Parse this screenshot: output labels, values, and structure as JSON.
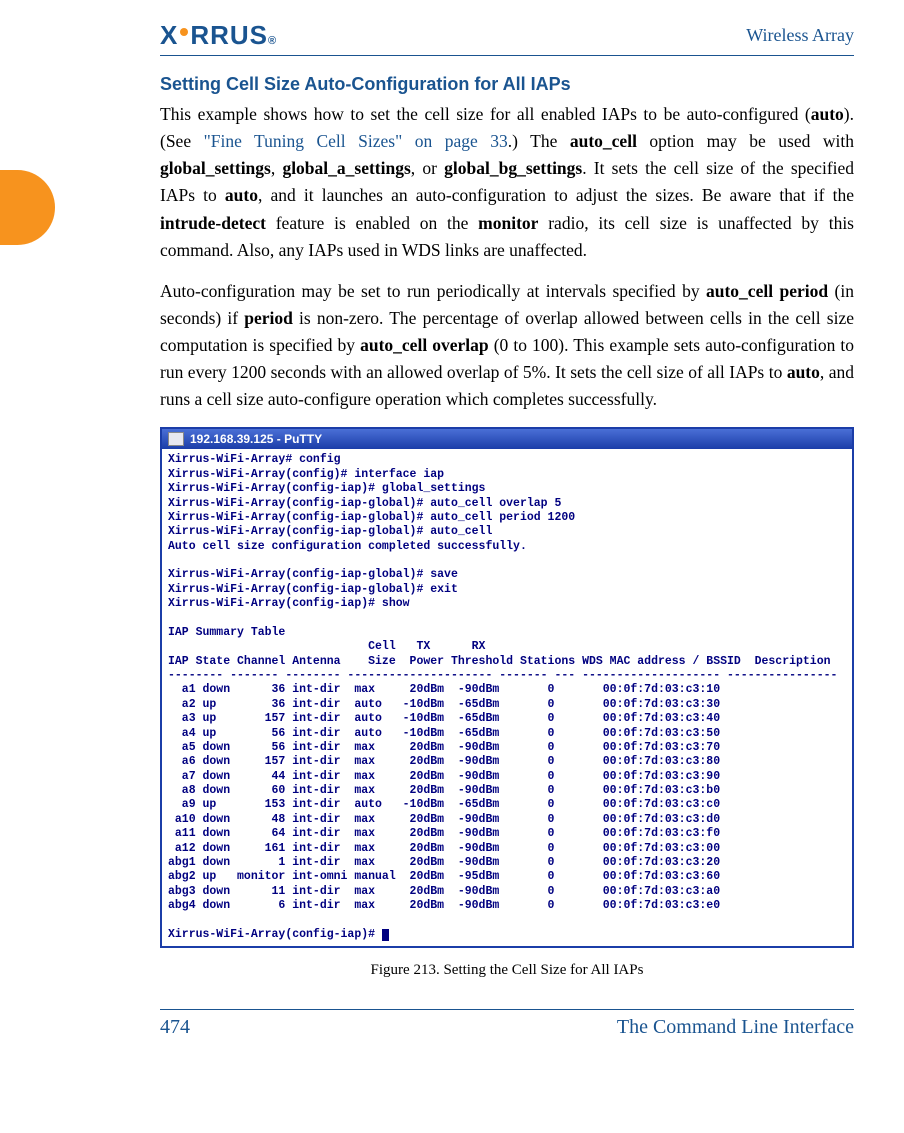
{
  "header": {
    "brand_text": "XIRRUS",
    "doc_title": "Wireless Array"
  },
  "section_title": "Setting Cell Size Auto-Configuration for All IAPs",
  "para1": {
    "t1": "This example shows how to set the cell size for all enabled IAPs to be auto-configured (",
    "bold1": "auto",
    "t2": "). (See ",
    "link1": "\"Fine Tuning Cell Sizes\" on page 33",
    "t3": ".) The ",
    "bold2": "auto_cell",
    "t4": " option may be used with ",
    "bold3": "global_settings",
    "t5": ", ",
    "bold4": "global_a_settings",
    "t6": ", or ",
    "bold5": "global_bg_settings",
    "t7": ". It sets the cell size of the specified IAPs to ",
    "bold6": "auto",
    "t8": ", and it launches an auto-configuration to adjust the sizes. Be aware that if the ",
    "bold7": "intrude-detect",
    "t9": " feature is enabled on the ",
    "bold8": "monitor",
    "t10": " radio, its cell size is unaffected by this command. Also, any IAPs used in WDS links are unaffected."
  },
  "para2": {
    "t1": "Auto-configuration may be set to run periodically at intervals specified by ",
    "bold1": "auto_cell period",
    "t2": " (in seconds) if ",
    "bold2": "period",
    "t3": " is non-zero. The percentage of overlap allowed between cells in the cell size computation is specified by ",
    "bold3": "auto_cell overlap",
    "t4": " (0 to 100). This example sets auto-configuration to run every 1200 seconds with an allowed overlap of 5%. It sets the cell size of all IAPs to ",
    "bold4": "auto",
    "t5": ", and runs a cell size auto-configure operation which completes successfully."
  },
  "terminal": {
    "title": "192.168.39.125 - PuTTY",
    "lines_pre": [
      "Xirrus-WiFi-Array# config",
      "Xirrus-WiFi-Array(config)# interface iap",
      "Xirrus-WiFi-Array(config-iap)# global_settings",
      "Xirrus-WiFi-Array(config-iap-global)# auto_cell overlap 5",
      "Xirrus-WiFi-Array(config-iap-global)# auto_cell period 1200",
      "Xirrus-WiFi-Array(config-iap-global)# auto_cell",
      "Auto cell size configuration completed successfully.",
      "",
      "Xirrus-WiFi-Array(config-iap-global)# save",
      "Xirrus-WiFi-Array(config-iap-global)# exit",
      "Xirrus-WiFi-Array(config-iap)# show",
      "",
      "IAP Summary Table",
      "                             Cell   TX      RX",
      "IAP State Channel Antenna    Size  Power Threshold Stations WDS MAC address / BSSID  Description",
      "-------- ------- -------- --------------------- ------- --- -------------------- ----------------"
    ],
    "rows": [
      {
        "iap": "a1",
        "state": "down",
        "ch": "36",
        "ant": "int-dir",
        "cell": "max",
        "tx": "20dBm",
        "rx": "-90dBm",
        "sta": "0",
        "mac": "00:0f:7d:03:c3:10"
      },
      {
        "iap": "a2",
        "state": "up",
        "ch": "36",
        "ant": "int-dir",
        "cell": "auto",
        "tx": "-10dBm",
        "rx": "-65dBm",
        "sta": "0",
        "mac": "00:0f:7d:03:c3:30"
      },
      {
        "iap": "a3",
        "state": "up",
        "ch": "157",
        "ant": "int-dir",
        "cell": "auto",
        "tx": "-10dBm",
        "rx": "-65dBm",
        "sta": "0",
        "mac": "00:0f:7d:03:c3:40"
      },
      {
        "iap": "a4",
        "state": "up",
        "ch": "56",
        "ant": "int-dir",
        "cell": "auto",
        "tx": "-10dBm",
        "rx": "-65dBm",
        "sta": "0",
        "mac": "00:0f:7d:03:c3:50"
      },
      {
        "iap": "a5",
        "state": "down",
        "ch": "56",
        "ant": "int-dir",
        "cell": "max",
        "tx": "20dBm",
        "rx": "-90dBm",
        "sta": "0",
        "mac": "00:0f:7d:03:c3:70"
      },
      {
        "iap": "a6",
        "state": "down",
        "ch": "157",
        "ant": "int-dir",
        "cell": "max",
        "tx": "20dBm",
        "rx": "-90dBm",
        "sta": "0",
        "mac": "00:0f:7d:03:c3:80"
      },
      {
        "iap": "a7",
        "state": "down",
        "ch": "44",
        "ant": "int-dir",
        "cell": "max",
        "tx": "20dBm",
        "rx": "-90dBm",
        "sta": "0",
        "mac": "00:0f:7d:03:c3:90"
      },
      {
        "iap": "a8",
        "state": "down",
        "ch": "60",
        "ant": "int-dir",
        "cell": "max",
        "tx": "20dBm",
        "rx": "-90dBm",
        "sta": "0",
        "mac": "00:0f:7d:03:c3:b0"
      },
      {
        "iap": "a9",
        "state": "up",
        "ch": "153",
        "ant": "int-dir",
        "cell": "auto",
        "tx": "-10dBm",
        "rx": "-65dBm",
        "sta": "0",
        "mac": "00:0f:7d:03:c3:c0"
      },
      {
        "iap": "a10",
        "state": "down",
        "ch": "48",
        "ant": "int-dir",
        "cell": "max",
        "tx": "20dBm",
        "rx": "-90dBm",
        "sta": "0",
        "mac": "00:0f:7d:03:c3:d0"
      },
      {
        "iap": "a11",
        "state": "down",
        "ch": "64",
        "ant": "int-dir",
        "cell": "max",
        "tx": "20dBm",
        "rx": "-90dBm",
        "sta": "0",
        "mac": "00:0f:7d:03:c3:f0"
      },
      {
        "iap": "a12",
        "state": "down",
        "ch": "161",
        "ant": "int-dir",
        "cell": "max",
        "tx": "20dBm",
        "rx": "-90dBm",
        "sta": "0",
        "mac": "00:0f:7d:03:c3:00"
      },
      {
        "iap": "abg1",
        "state": "down",
        "ch": "1",
        "ant": "int-dir",
        "cell": "max",
        "tx": "20dBm",
        "rx": "-90dBm",
        "sta": "0",
        "mac": "00:0f:7d:03:c3:20"
      },
      {
        "iap": "abg2",
        "state": "up",
        "ch": "monitor",
        "ant": "int-omni",
        "cell": "manual",
        "tx": "20dBm",
        "rx": "-95dBm",
        "sta": "0",
        "mac": "00:0f:7d:03:c3:60"
      },
      {
        "iap": "abg3",
        "state": "down",
        "ch": "11",
        "ant": "int-dir",
        "cell": "max",
        "tx": "20dBm",
        "rx": "-90dBm",
        "sta": "0",
        "mac": "00:0f:7d:03:c3:a0"
      },
      {
        "iap": "abg4",
        "state": "down",
        "ch": "6",
        "ant": "int-dir",
        "cell": "max",
        "tx": "20dBm",
        "rx": "-90dBm",
        "sta": "0",
        "mac": "00:0f:7d:03:c3:e0"
      }
    ],
    "prompt": "Xirrus-WiFi-Array(config-iap)# "
  },
  "figure_caption": "Figure 213. Setting the Cell Size for All IAPs",
  "footer": {
    "page": "474",
    "section": "The Command Line Interface"
  }
}
